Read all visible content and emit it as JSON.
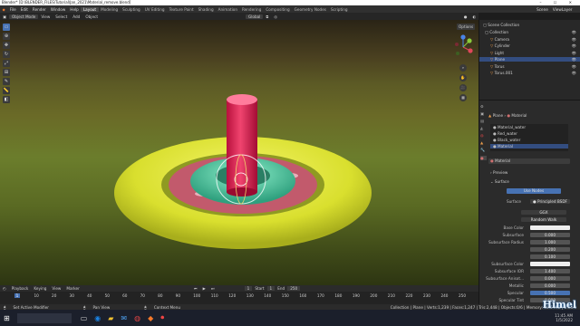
{
  "titlebar": {
    "text": "Blender* [D:\\BLENDER_FILES\\Tutorial\\Jan_2021\\Material_remove.blend]",
    "controls": "– ☐ ✕"
  },
  "menu": {
    "items": [
      "File",
      "Edit",
      "Render",
      "Window",
      "Help"
    ],
    "tabs": [
      "Layout",
      "Modeling",
      "Sculpting",
      "UV Editing",
      "Texture Paint",
      "Shading",
      "Animation",
      "Rendering",
      "Compositing",
      "Geometry Nodes",
      "Scripting"
    ],
    "active_tab": "Layout",
    "scene_label": "Scene",
    "viewlayer_label": "ViewLayer"
  },
  "viewport_header": {
    "mode": "Object Mode",
    "view": "View",
    "select": "Select",
    "add": "Add",
    "object": "Object",
    "orientation": "Global",
    "options": "Options"
  },
  "toolbar": {
    "tools": [
      "cursor-icon",
      "move-icon",
      "rotate-icon",
      "scale-icon",
      "transform-icon",
      "annotate-icon",
      "measure-icon",
      "add-cube-icon"
    ]
  },
  "outliner": {
    "root": "Scene Collection",
    "items": [
      {
        "label": "Collection",
        "depth": 0,
        "selected": false
      },
      {
        "label": "Camera",
        "depth": 1,
        "selected": false
      },
      {
        "label": "Cylinder",
        "depth": 1,
        "selected": false
      },
      {
        "label": "Light",
        "depth": 1,
        "selected": false
      },
      {
        "label": "Plane",
        "depth": 1,
        "selected": true
      },
      {
        "label": "Torus",
        "depth": 1,
        "selected": false
      },
      {
        "label": "Torus.001",
        "depth": 1,
        "selected": false
      }
    ]
  },
  "properties": {
    "breadcrumb_object": "Plane",
    "breadcrumb_material": "Material",
    "slots": [
      "Material_water",
      "Red_water",
      "Black_water",
      "Material"
    ],
    "active_material": "Material",
    "preview": "Preview",
    "surface": "Surface",
    "use_nodes": "Use Nodes",
    "surface_field_label": "Surface",
    "surface_shader": "Principled BSDF",
    "distribution": "GGX",
    "subsurface_method": "Random Walk",
    "rows": [
      {
        "label": "Base Color",
        "value": ""
      },
      {
        "label": "Subsurface",
        "value": "0.000"
      },
      {
        "label": "Subsurface Radius",
        "value": "1.000"
      },
      {
        "label": "",
        "value": "0.200"
      },
      {
        "label": "",
        "value": "0.100"
      },
      {
        "label": "Subsurface Color",
        "value": ""
      },
      {
        "label": "Subsurface IOR",
        "value": "1.400"
      },
      {
        "label": "Subsurface Anisot...",
        "value": "0.000"
      },
      {
        "label": "Metallic",
        "value": "0.000"
      },
      {
        "label": "Specular",
        "value": "0.500"
      },
      {
        "label": "Specular Tint",
        "value": "0.000"
      }
    ]
  },
  "timeline": {
    "playback": "Playback",
    "keying": "Keying",
    "view": "View",
    "marker": "Marker",
    "current_frame": "1",
    "start_label": "Start",
    "start": "1",
    "end_label": "End",
    "end": "250",
    "ticks": [
      "1",
      "10",
      "20",
      "30",
      "40",
      "50",
      "60",
      "70",
      "80",
      "90",
      "100",
      "110",
      "120",
      "130",
      "140",
      "150",
      "160",
      "170",
      "180",
      "190",
      "200",
      "210",
      "220",
      "230",
      "240",
      "250"
    ]
  },
  "status": {
    "left": "Set Active Modifier",
    "middle1": "Pan View",
    "middle2": "Context Menu",
    "right": "Collection | Plane | Verts:1,239 | Faces:1,247 | Tris:2,448 | Objects:0/6 | Memory: 40.6 MiB | 2.93.0"
  },
  "taskbar": {
    "watermark": "Himel",
    "clock_time": "11:45 AM",
    "clock_date": "1/5/2022"
  },
  "colors": {
    "accent": "#4772b3",
    "viewport_grass": "#6b7d2c",
    "yellow_torus": "#e3e83b",
    "teal_torus": "#4fc7a1",
    "red_cylinder": "#e0204f",
    "pink_plane": "#c2586a"
  }
}
